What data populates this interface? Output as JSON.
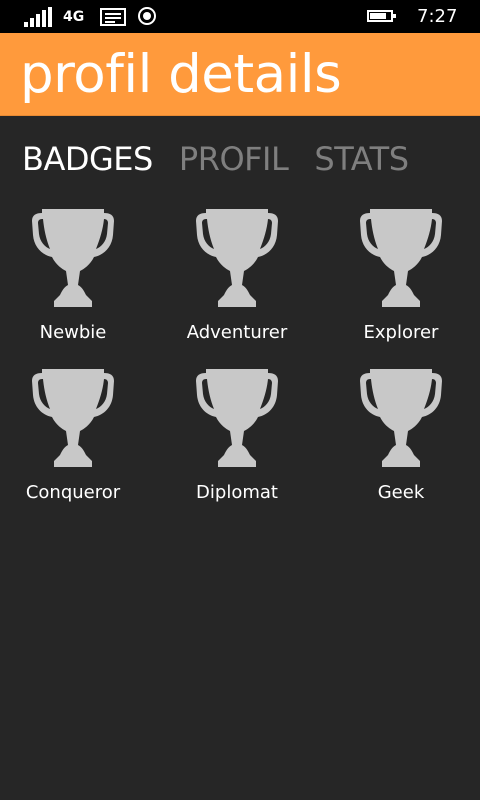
{
  "status_bar": {
    "network_type": "4G",
    "time": "7:27",
    "signal_bars": 5,
    "battery_level": 0.8
  },
  "header": {
    "title": "profil details",
    "background_color": "#ff9a3c"
  },
  "pivot": {
    "tabs": [
      {
        "label": "BADGES",
        "active": true
      },
      {
        "label": "PROFIL",
        "active": false
      },
      {
        "label": "STATS",
        "active": false
      }
    ]
  },
  "badges": [
    {
      "label": "Newbie",
      "icon": "trophy-icon"
    },
    {
      "label": "Adventurer",
      "icon": "trophy-icon"
    },
    {
      "label": "Explorer",
      "icon": "trophy-icon"
    },
    {
      "label": "Conqueror",
      "icon": "trophy-icon"
    },
    {
      "label": "Diplomat",
      "icon": "trophy-icon"
    },
    {
      "label": "Geek",
      "icon": "trophy-icon"
    }
  ],
  "colors": {
    "background": "#262626",
    "trophy": "#c8c8c8",
    "inactive_tab": "#7f7f7f"
  }
}
